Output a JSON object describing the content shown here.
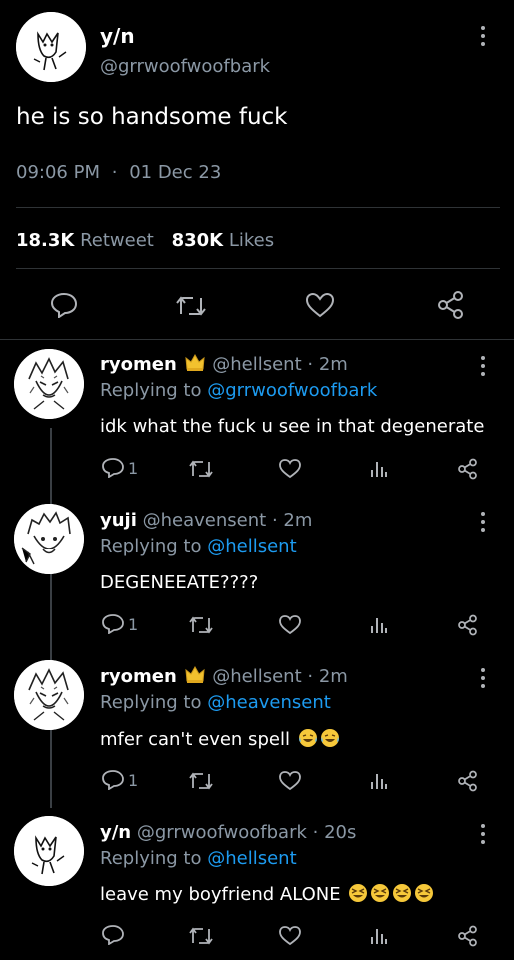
{
  "main_tweet": {
    "display_name": "y/n",
    "handle": "@grrwoofwoofbark",
    "text": "he is so handsome fuck",
    "time": "09:06 PM",
    "separator": "·",
    "date": "01 Dec 23",
    "retweets_count": "18.3K",
    "retweets_label": "Retweet",
    "likes_count": "830K",
    "likes_label": "Likes"
  },
  "replies": [
    {
      "name": "ryomen",
      "crown": true,
      "handle": "@hellsent",
      "time": "· 2m",
      "replying_prefix": "Replying to",
      "replying_to": "@grrwoofwoofbark",
      "text": "idk what the fuck u see in that degenerate",
      "reply_count": "1"
    },
    {
      "name": "yuji",
      "crown": false,
      "handle": "@heavensent",
      "time": "· 2m",
      "replying_prefix": "Replying to",
      "replying_to": "@hellsent",
      "text": "DEGENEEATE????",
      "reply_count": "1"
    },
    {
      "name": "ryomen",
      "crown": true,
      "handle": "@hellsent",
      "time": "· 2m",
      "replying_prefix": "Replying to",
      "replying_to": "@heavensent",
      "text": "mfer can't even spell",
      "emojis": [
        "laughing-tears-emoji",
        "laughing-tears-emoji"
      ],
      "reply_count": "1"
    },
    {
      "name": "y/n",
      "crown": false,
      "handle": "@grrwoofwoofbark",
      "time": "· 20s",
      "replying_prefix": "Replying to",
      "replying_to": "@hellsent",
      "text": "leave my boyfriend ALONE",
      "emojis": [
        "squint-grin-emoji",
        "squint-grin-emoji",
        "squint-grin-emoji",
        "squint-grin-emoji"
      ],
      "reply_count": ""
    }
  ],
  "colors": {
    "link": "#1d9bf0",
    "muted": "#8b98a5",
    "background": "#000000"
  }
}
